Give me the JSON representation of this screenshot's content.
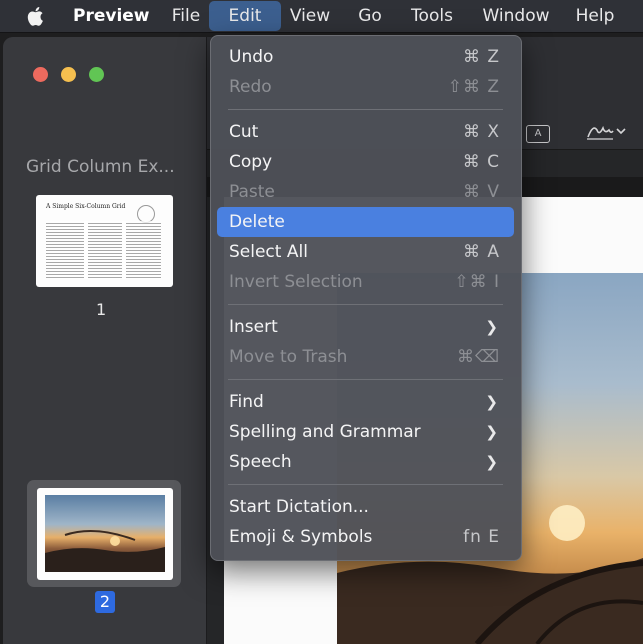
{
  "menubar": {
    "apple_icon": "apple-logo",
    "items": [
      {
        "label": "Preview"
      },
      {
        "label": "File"
      },
      {
        "label": "Edit"
      },
      {
        "label": "View"
      },
      {
        "label": "Go"
      },
      {
        "label": "Tools"
      },
      {
        "label": "Window"
      },
      {
        "label": "Help"
      }
    ]
  },
  "sidebar": {
    "doc_title": "Grid Column Ex...",
    "thumb1_heading": "A Simple Six-Column Grid",
    "pages": [
      "1",
      "2"
    ],
    "selected_page": "2"
  },
  "toolbar": {
    "textbox_label": "A"
  },
  "edit_menu": {
    "items": [
      {
        "label": "Undo",
        "shortcut": "⌘ Z",
        "enabled": true
      },
      {
        "label": "Redo",
        "shortcut": "⇧⌘ Z",
        "enabled": false
      },
      {
        "label": "Cut",
        "shortcut": "⌘ X",
        "enabled": true
      },
      {
        "label": "Copy",
        "shortcut": "⌘ C",
        "enabled": true
      },
      {
        "label": "Paste",
        "shortcut": "⌘ V",
        "enabled": false
      },
      {
        "label": "Delete",
        "shortcut": "",
        "enabled": true,
        "highlighted": true
      },
      {
        "label": "Select All",
        "shortcut": "⌘ A",
        "enabled": true
      },
      {
        "label": "Invert Selection",
        "shortcut": "⇧⌘ I",
        "enabled": false
      },
      {
        "label": "Insert",
        "submenu": true,
        "enabled": true
      },
      {
        "label": "Move to Trash",
        "shortcut": "⌘⌫",
        "enabled": false
      },
      {
        "label": "Find",
        "submenu": true,
        "enabled": true
      },
      {
        "label": "Spelling and Grammar",
        "submenu": true,
        "enabled": true
      },
      {
        "label": "Speech",
        "submenu": true,
        "enabled": true
      },
      {
        "label": "Start Dictation...",
        "shortcut": "",
        "enabled": true
      },
      {
        "label": "Emoji & Symbols",
        "shortcut": "fn E",
        "enabled": true
      }
    ]
  },
  "colors": {
    "highlight": "#4a80e0",
    "selected_page_badge": "#2e6ae0"
  }
}
